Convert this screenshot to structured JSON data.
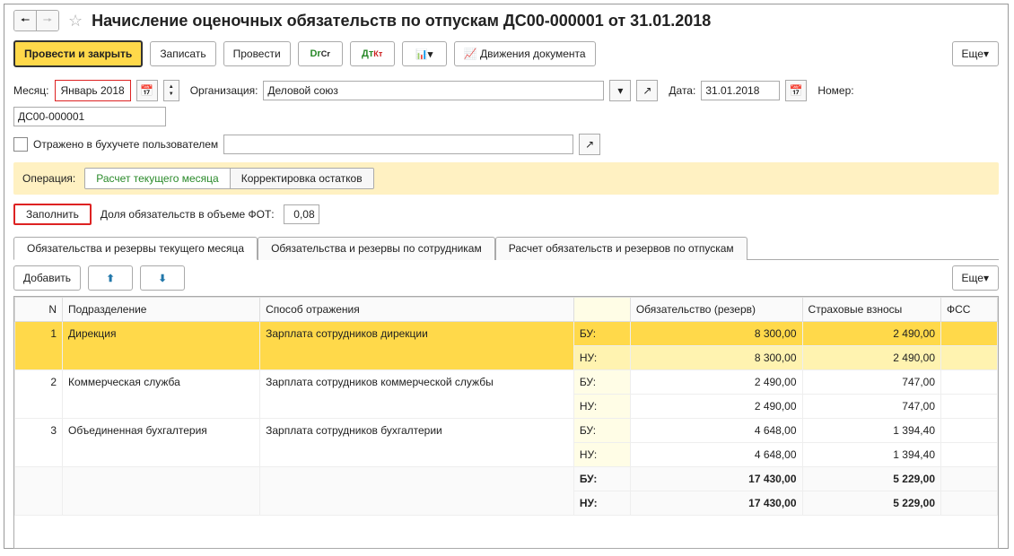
{
  "title": "Начисление оценочных обязательств по отпускам ДС00-000001 от 31.01.2018",
  "toolbar": {
    "post_close": "Провести и закрыть",
    "save": "Записать",
    "post": "Провести",
    "movements": "Движения документа",
    "more": "Еще"
  },
  "header": {
    "month_label": "Месяц:",
    "month_value": "Январь 2018",
    "org_label": "Организация:",
    "org_value": "Деловой союз",
    "date_label": "Дата:",
    "date_value": "31.01.2018",
    "number_label": "Номер:",
    "number_value": "ДС00-000001",
    "reflected_label": "Отражено в бухучете пользователем"
  },
  "operation": {
    "label": "Операция:",
    "seg1": "Расчет текущего месяца",
    "seg2": "Корректировка остатков"
  },
  "fill": {
    "button": "Заполнить",
    "share_label": "Доля обязательств в объеме ФОТ:",
    "share_value": "0,08"
  },
  "tabs": {
    "t1": "Обязательства и резервы текущего месяца",
    "t2": "Обязательства и резервы по сотрудникам",
    "t3": "Расчет обязательств и резервов по отпускам"
  },
  "grid": {
    "add": "Добавить",
    "more": "Еще",
    "cols": {
      "n": "N",
      "dept": "Подразделение",
      "method": "Способ отражения",
      "bu": "",
      "reserve": "Обязательство (резерв)",
      "ins": "Страховые взносы",
      "fss": "ФСС"
    },
    "rows": [
      {
        "n": "1",
        "dept": "Дирекция",
        "method": "Зарплата сотрудников дирекции",
        "bu1": "БУ:",
        "bu2": "НУ:",
        "res1": "8 300,00",
        "res2": "8 300,00",
        "ins1": "2 490,00",
        "ins2": "2 490,00",
        "sel": true
      },
      {
        "n": "2",
        "dept": "Коммерческая служба",
        "method": "Зарплата сотрудников коммерческой службы",
        "bu1": "БУ:",
        "bu2": "НУ:",
        "res1": "2 490,00",
        "res2": "2 490,00",
        "ins1": "747,00",
        "ins2": "747,00",
        "sel": false
      },
      {
        "n": "3",
        "dept": "Объединенная бухгалтерия",
        "method": "Зарплата сотрудников бухгалтерии",
        "bu1": "БУ:",
        "bu2": "НУ:",
        "res1": "4 648,00",
        "res2": "4 648,00",
        "ins1": "1 394,40",
        "ins2": "1 394,40",
        "sel": false
      }
    ],
    "total": {
      "bu1": "БУ:",
      "bu2": "НУ:",
      "res1": "17 430,00",
      "res2": "17 430,00",
      "ins1": "5 229,00",
      "ins2": "5 229,00"
    }
  }
}
